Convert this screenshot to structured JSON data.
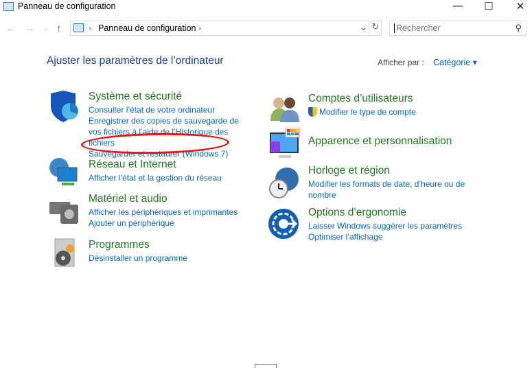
{
  "window": {
    "title": "Panneau de configuration",
    "minimize": "—",
    "maximize": "☐",
    "close": "✕"
  },
  "toolbar": {
    "back": "←",
    "forward": "→",
    "recent": "⌄",
    "up": "↑",
    "breadcrumb": "Panneau de configuration",
    "sep": "›",
    "dropdown": "⌄",
    "refresh": "↻",
    "search_placeholder": "Rechercher",
    "search_icon": "⚲"
  },
  "main": {
    "heading": "Ajuster les paramètres de l’ordinateur",
    "view_by_label": "Afficher par :",
    "view_by_value": "Catégorie ▾"
  },
  "categories_left": [
    {
      "title": "Système et sécurité",
      "links": [
        "Consulter l’état de votre ordinateur",
        "Enregistrer des copies de sauvegarde de vos fichiers à l’aide de l’Historique des fichiers",
        "Sauvegarder et restaurer (Windows 7)"
      ]
    },
    {
      "title": "Réseau et Internet",
      "links": [
        "Afficher l’état et la gestion du réseau"
      ]
    },
    {
      "title": "Matériel et audio",
      "links": [
        "Afficher les périphériques et imprimantes",
        "Ajouter un périphérique"
      ]
    },
    {
      "title": "Programmes",
      "links": [
        "Désinstaller un programme"
      ]
    }
  ],
  "categories_right": [
    {
      "title": "Comptes d’utilisateurs",
      "links": [
        "Modifier le type de compte"
      ]
    },
    {
      "title": "Apparence et personnalisation",
      "links": []
    },
    {
      "title": "Horloge et région",
      "links": [
        "Modifier les formats de date, d’heure ou de nombre"
      ]
    },
    {
      "title": "Options d’ergonomie",
      "links": [
        "Laisser Windows suggérer les paramètres",
        "Optimiser l’affichage"
      ]
    }
  ],
  "colors": {
    "category": "#1f7a1f",
    "link": "#0066cc",
    "heading": "#1e3c8c",
    "annotation": "#e01818"
  }
}
